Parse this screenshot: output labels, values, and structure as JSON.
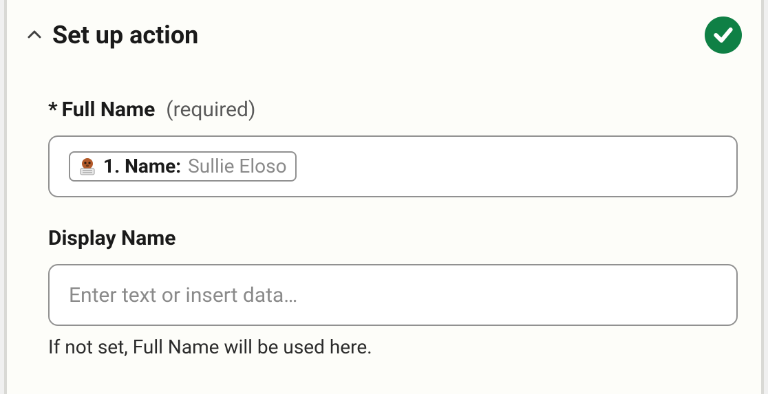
{
  "section": {
    "title": "Set up action",
    "status": "complete"
  },
  "fields": {
    "full_name": {
      "asterisk": "*",
      "label": "Full Name",
      "required_text": "(required)",
      "pill": {
        "label": "1. Name:",
        "value": "Sullie Eloso"
      }
    },
    "display_name": {
      "label": "Display Name",
      "placeholder": "Enter text or insert data…",
      "helper": "If not set, Full Name will be used here."
    }
  }
}
